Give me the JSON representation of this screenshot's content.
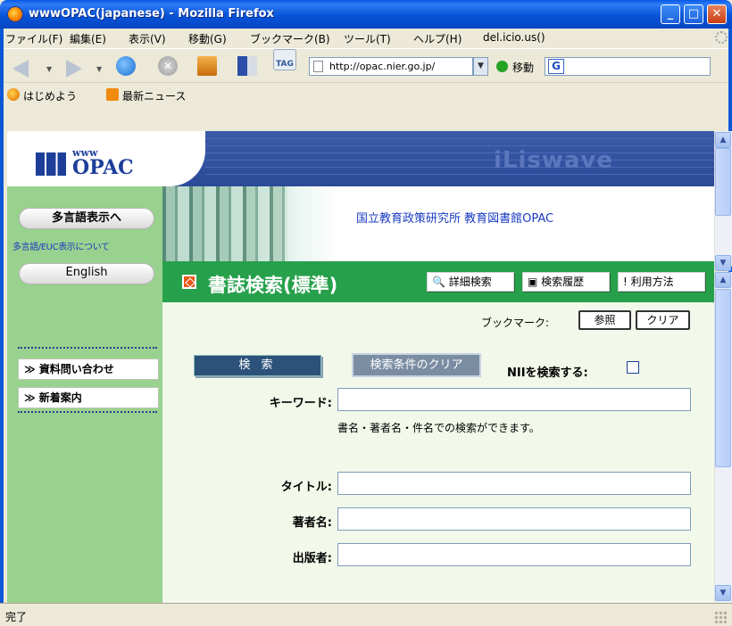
{
  "window": {
    "title": "wwwOPAC(japanese) - Mozilla Firefox",
    "minimize": "_",
    "maximize": "□",
    "close": "✕"
  },
  "menu": {
    "items": [
      "ファイル(F)",
      "編集(E)",
      "表示(V)",
      "移動(G)",
      "ブックマーク(B)",
      "ツール(T)",
      "ヘルプ(H)",
      "del.icio.us()"
    ]
  },
  "nav": {
    "url": "http://opac.nier.go.jp/",
    "go_label": "移動",
    "tag_label": "TAG",
    "search_engine": "G",
    "url_drop": "▼",
    "stop": "✕",
    "drop": "▼"
  },
  "bookmarks": {
    "items": [
      "はじめよう",
      "最新ニュース"
    ]
  },
  "header": {
    "logo_www": "www",
    "logo_opac": "OPAC",
    "brand": "iLiswave"
  },
  "sidebar": {
    "multilang_button": "多言語表示へ",
    "multilang_note": "多言語/EUC表示について",
    "english_button": "English",
    "links": [
      "≫ 資料問い合わせ",
      "≫ 新着案内"
    ]
  },
  "main": {
    "banner_title": "国立教育政策研究所 教育図書館OPAC",
    "page_heading": "書誌検索(標準)",
    "tool_buttons": [
      "🔍 詳細検索",
      "▣ 検索履歴",
      "! 利用方法"
    ],
    "bookmark_label": "ブックマーク:",
    "browse_button": "参照",
    "clear_bm_button": "クリア",
    "search_button": "検 索",
    "clear_cond_button": "検索条件のクリア",
    "nii_label": "NIIを検索する:",
    "fields": {
      "keyword_label": "キーワード:",
      "keyword_value": "",
      "keyword_hint": "書名・著者名・件名での検索ができます。",
      "title_label": "タイトル:",
      "title_value": "",
      "author_label": "著者名:",
      "author_value": "",
      "publisher_label": "出版者:",
      "publisher_value": ""
    }
  },
  "status": {
    "text": "完了"
  }
}
